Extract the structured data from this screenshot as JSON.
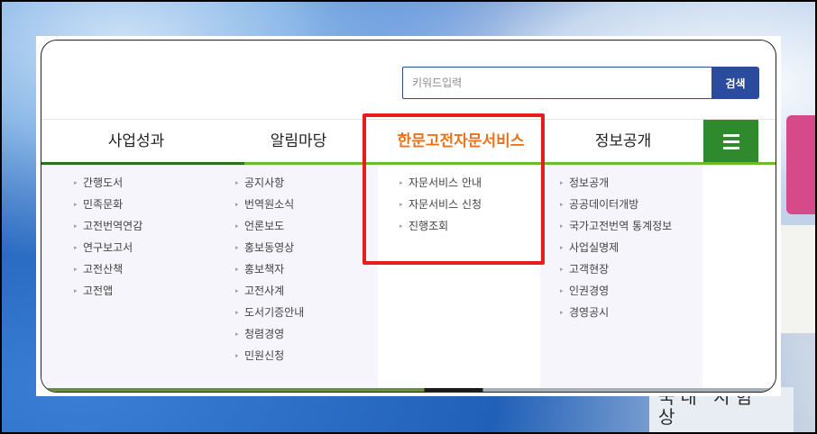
{
  "search": {
    "placeholder": "키워드입력",
    "button_label": "검색"
  },
  "nav": {
    "items": [
      {
        "label": "사업성과"
      },
      {
        "label": "알림마당"
      },
      {
        "label": "한문고전자문서비스"
      },
      {
        "label": "정보공개"
      }
    ],
    "active_index": 2,
    "menu_icon": "hamburger-icon"
  },
  "submenus": {
    "business": [
      "간행도서",
      "민족문화",
      "고전번역연감",
      "연구보고서",
      "고전산책",
      "고전앱"
    ],
    "notice": [
      "공지사항",
      "번역원소식",
      "언론보도",
      "홍보동영상",
      "홍보책자",
      "고전사계",
      "도서기증안내",
      "청렴경영",
      "민원신청"
    ],
    "advisory": [
      "자문서비스 안내",
      "자문서비스 신청",
      "진행조회"
    ],
    "disclosure": [
      "정보공개",
      "공공데이터개방",
      "국가고전번역 통계정보",
      "사업실명제",
      "고객현장",
      "인권경영",
      "경영공시"
    ]
  },
  "background_text": "국내 시험\n상",
  "colors": {
    "active": "#e8731e",
    "green_bar": "#6fba2c",
    "menu_button": "#2f8a2d",
    "search_button": "#2b4c9e",
    "highlight_box": "#e81c1c"
  }
}
